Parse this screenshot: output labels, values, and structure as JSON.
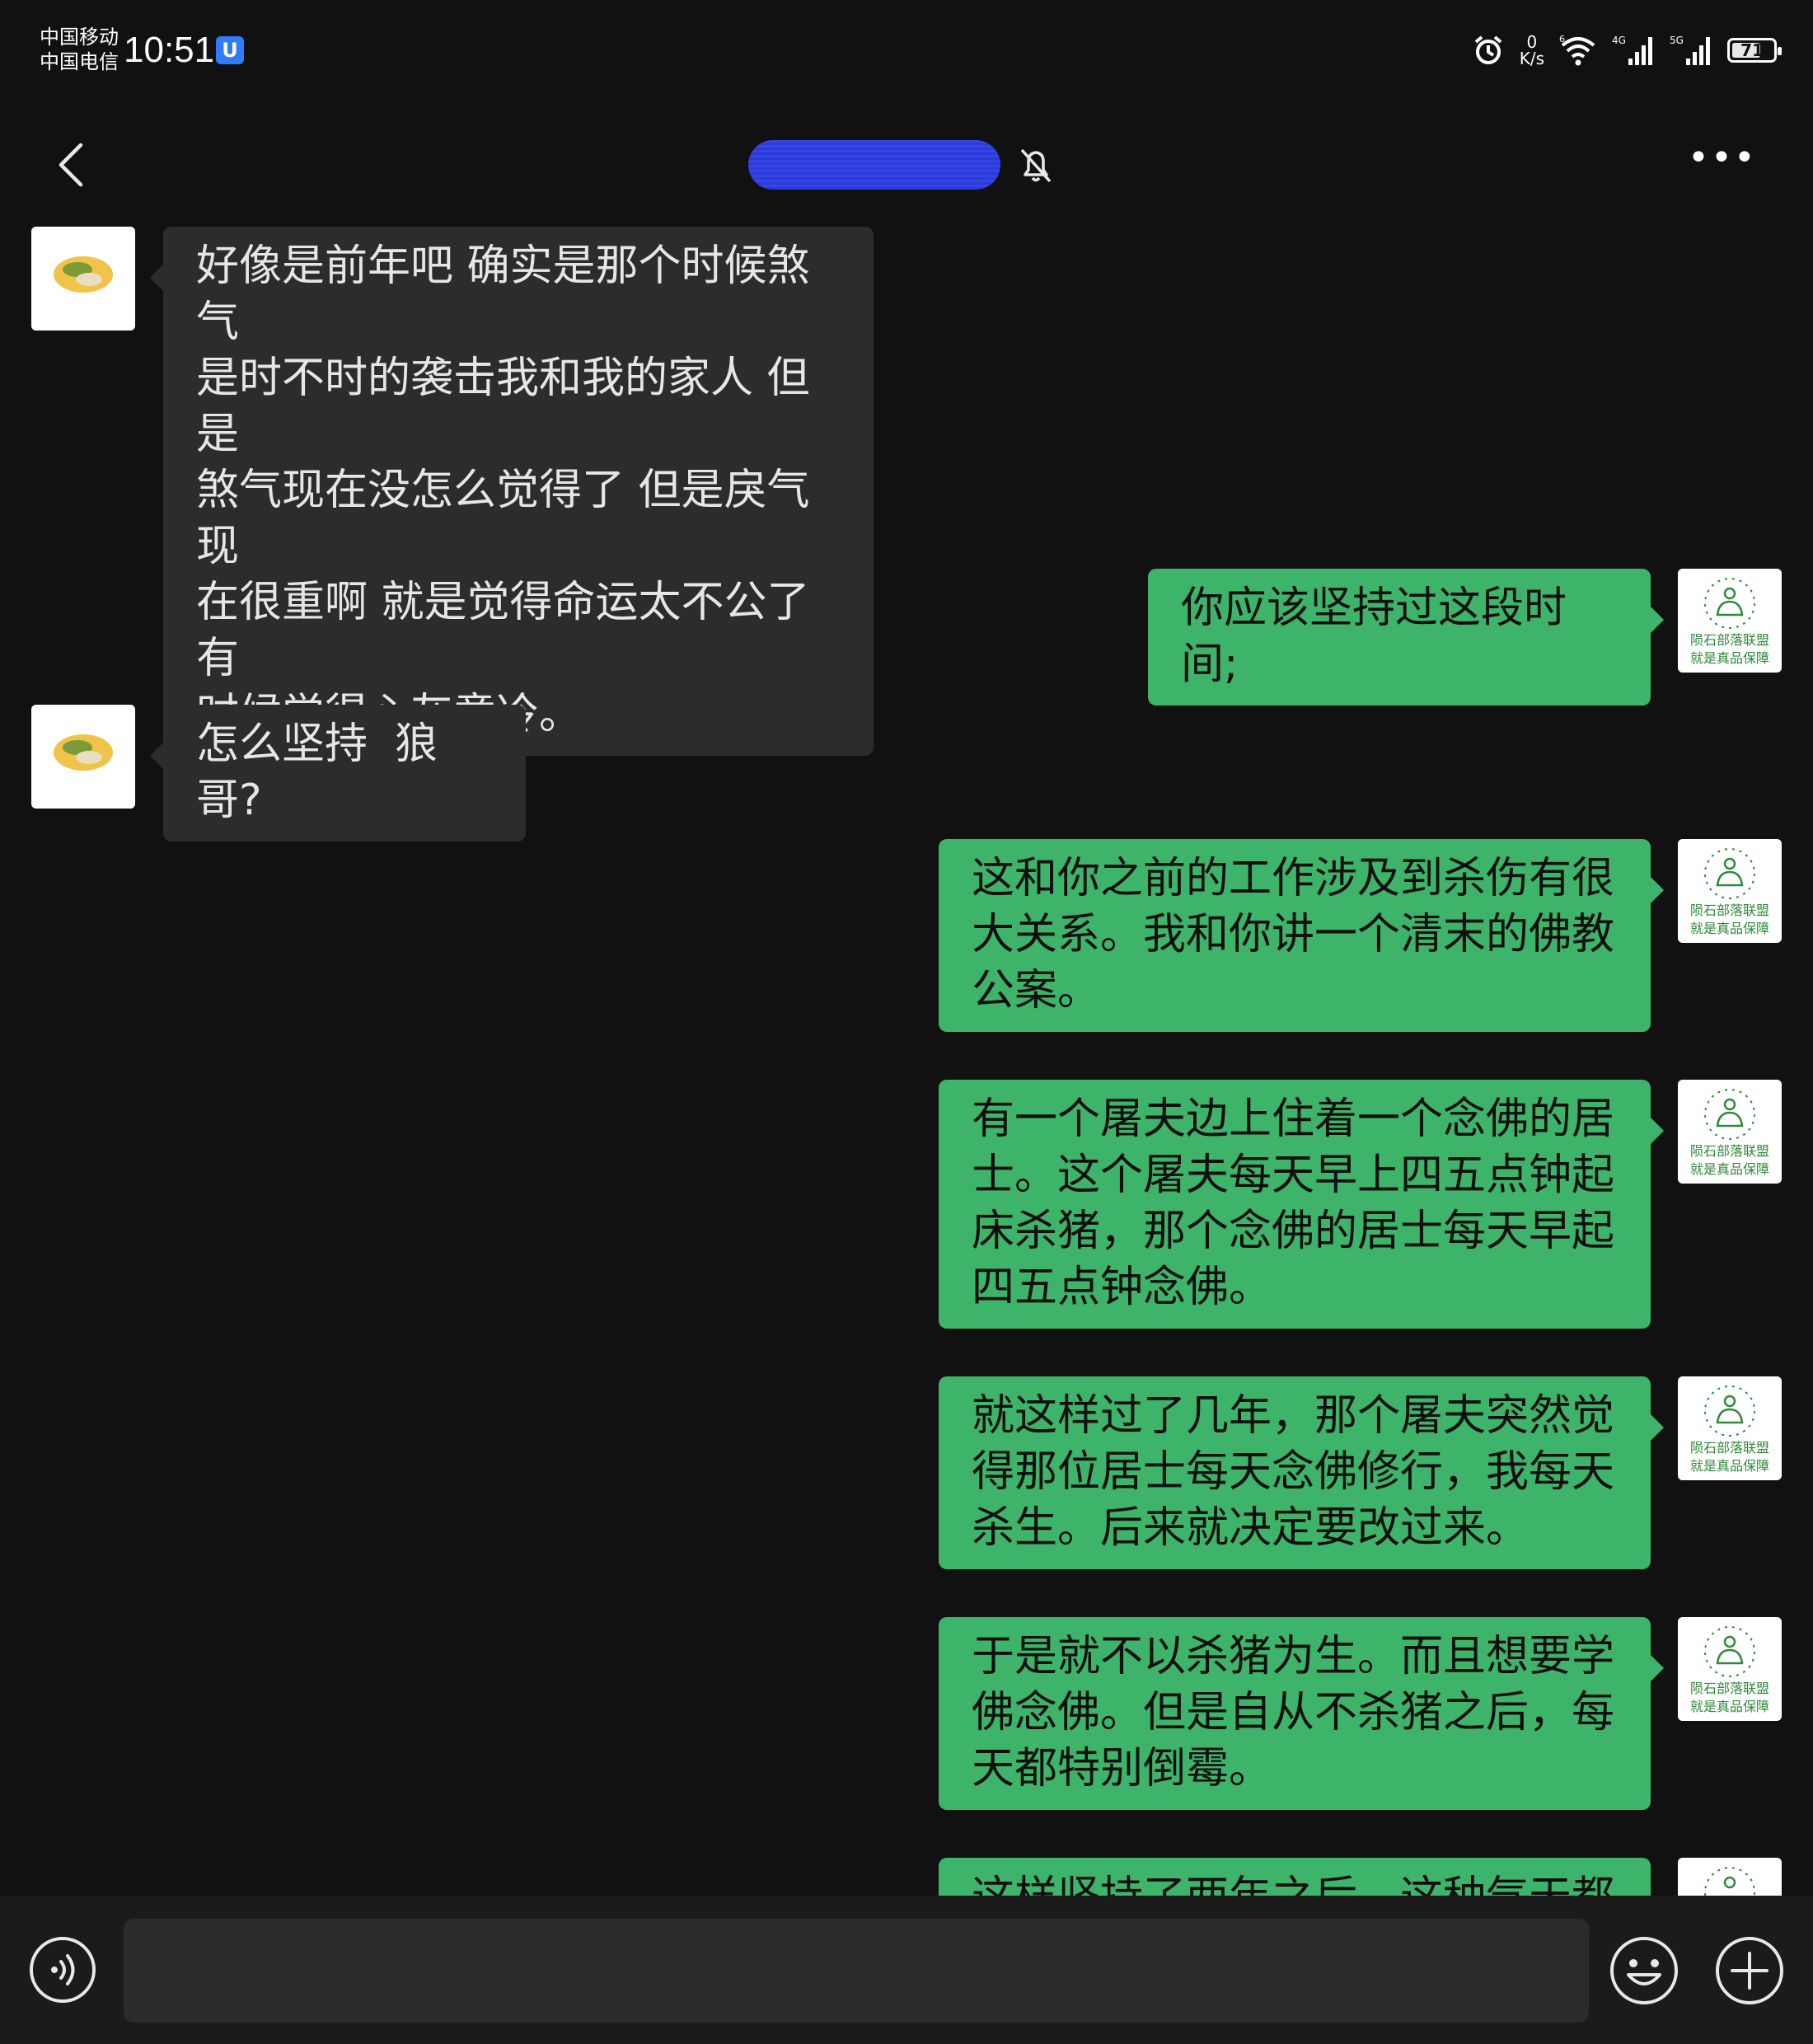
{
  "status_bar": {
    "carrier_1": "中国移动",
    "carrier_2": "中国电信",
    "time": "10:51",
    "app_badge": "U",
    "net_speed_value": "0",
    "net_speed_unit": "K/s",
    "battery_percent": "71",
    "battery_level": 0.71,
    "signal_1_label": "4G",
    "signal_2_label": "5G",
    "wifi_label": "6"
  },
  "header": {
    "contact_name_redacted": true,
    "muted": true,
    "more_label": "•••"
  },
  "messages": [
    {
      "side": "in",
      "text": "好像是前年吧 确实是那个时候煞气\n是时不时的袭击我和我的家人 但是\n煞气现在没怎么觉得了 但是戾气现\n在很重啊 就是觉得命运太不公了有\n时候觉得心灰意冷。"
    },
    {
      "side": "out",
      "text": "你应该坚持过这段时间;"
    },
    {
      "side": "in",
      "text": "怎么坚持  狼哥?"
    },
    {
      "side": "out",
      "text": "这和你之前的工作涉及到杀伤有很\n大关系。我和你讲一个清末的佛教\n公案。"
    },
    {
      "side": "out",
      "text": "有一个屠夫边上住着一个念佛的居\n士。这个屠夫每天早上四五点钟起\n床杀猪，那个念佛的居士每天早起\n四五点钟念佛。"
    },
    {
      "side": "out",
      "text": "就这样过了几年，那个屠夫突然觉\n得那位居士每天念佛修行，我每天\n杀生。后来就决定要改过来。"
    },
    {
      "side": "out",
      "text": "于是就不以杀猪为生。而且想要学\n佛念佛。但是自从不杀猪之后，每\n天都特别倒霉。"
    },
    {
      "side": "out",
      "text": "这样坚持了两年之后，这种气天都"
    }
  ],
  "avatars": {
    "self_caption_line1": "陨石部落联盟",
    "self_caption_line2": "就是真品保障"
  },
  "input": {
    "placeholder": ""
  }
}
